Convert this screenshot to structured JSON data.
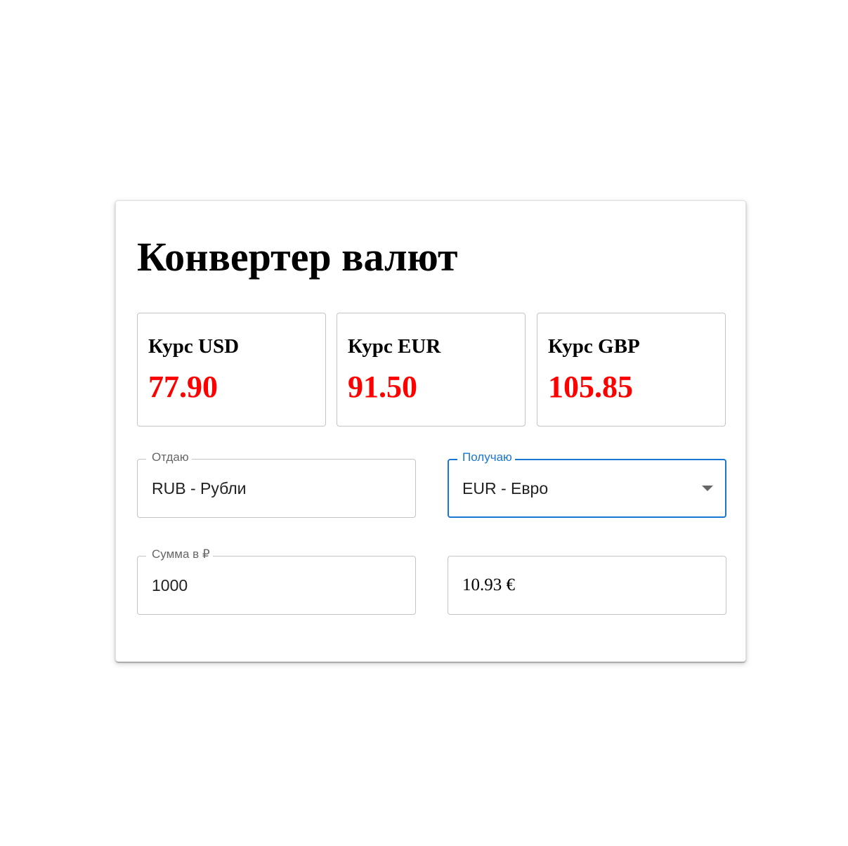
{
  "title": "Конвертер валют",
  "rates": [
    {
      "label": "Курс USD",
      "value": "77.90"
    },
    {
      "label": "Курс EUR",
      "value": "91.50"
    },
    {
      "label": "Курс GBP",
      "value": "105.85"
    }
  ],
  "from": {
    "label": "Отдаю",
    "value": "RUB - Рубли"
  },
  "to": {
    "label": "Получаю",
    "value": "EUR - Евро"
  },
  "amount": {
    "label": "Сумма в ₽",
    "value": "1000"
  },
  "result": {
    "value": "10.93 €"
  },
  "colors": {
    "accent": "#1976d2",
    "rate_value": "#ff0000",
    "border": "#c4c4c4"
  },
  "icons": {
    "select_arrow": "arrow-drop-down-icon"
  }
}
